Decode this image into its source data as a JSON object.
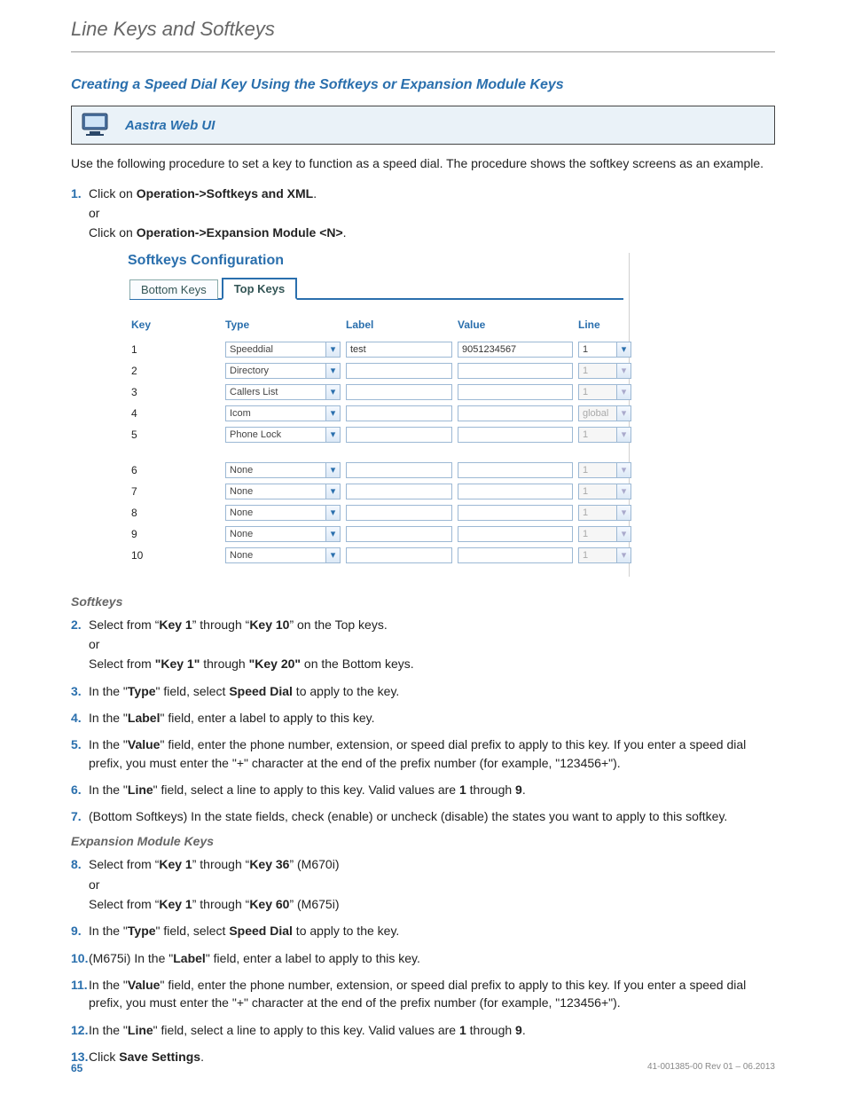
{
  "header": "Line Keys and Softkeys",
  "section_title": "Creating a Speed Dial Key Using the Softkeys or Expansion Module Keys",
  "callout_title": "Aastra Web UI",
  "intro": "Use the following procedure to set a key to function as a speed dial. The procedure shows the softkey screens as an example.",
  "step1": {
    "lead": "Click on ",
    "bold1": "Operation->Softkeys and XML",
    "tail1": ".",
    "or": "or",
    "lead2": "Click on ",
    "bold2": "Operation->Expansion Module <N>",
    "tail2": "."
  },
  "scr": {
    "title": "Softkeys Configuration",
    "tabs": {
      "bottom": "Bottom Keys",
      "top": "Top Keys"
    },
    "cols": {
      "key": "Key",
      "type": "Type",
      "label": "Label",
      "value": "Value",
      "line": "Line"
    },
    "rows": [
      {
        "key": "1",
        "type": "Speeddial",
        "label": "test",
        "value": "9051234567",
        "line": "1",
        "lineEnabled": true
      },
      {
        "key": "2",
        "type": "Directory",
        "label": "",
        "value": "",
        "line": "1",
        "lineEnabled": false
      },
      {
        "key": "3",
        "type": "Callers List",
        "label": "",
        "value": "",
        "line": "1",
        "lineEnabled": false
      },
      {
        "key": "4",
        "type": "Icom",
        "label": "",
        "value": "",
        "line": "global",
        "lineEnabled": false
      },
      {
        "key": "5",
        "type": "Phone Lock",
        "label": "",
        "value": "",
        "line": "1",
        "lineEnabled": false
      },
      {
        "key": "6",
        "type": "None",
        "label": "",
        "value": "",
        "line": "1",
        "lineEnabled": false
      },
      {
        "key": "7",
        "type": "None",
        "label": "",
        "value": "",
        "line": "1",
        "lineEnabled": false
      },
      {
        "key": "8",
        "type": "None",
        "label": "",
        "value": "",
        "line": "1",
        "lineEnabled": false
      },
      {
        "key": "9",
        "type": "None",
        "label": "",
        "value": "",
        "line": "1",
        "lineEnabled": false
      },
      {
        "key": "10",
        "type": "None",
        "label": "",
        "value": "",
        "line": "1",
        "lineEnabled": false
      }
    ]
  },
  "softkeys_heading": "Softkeys",
  "steps_a": {
    "s2a": "Select from “",
    "s2b": "Key 1",
    "s2c": "” through “",
    "s2d": "Key 10",
    "s2e": "” on the Top keys.",
    "s2or": "or",
    "s2f": "Select from ",
    "s2g": "\"Key 1\"",
    "s2h": " through ",
    "s2i": "\"Key 20\"",
    "s2j": " on the Bottom keys.",
    "s3a": "In the \"",
    "s3b": "Type",
    "s3c": "\" field, select ",
    "s3d": "Speed Dial",
    "s3e": " to apply to the key.",
    "s4a": "In the \"",
    "s4b": "Label",
    "s4c": "\" field, enter a label to apply to this key.",
    "s5a": "In the \"",
    "s5b": "Value",
    "s5c": "\" field, enter the phone number, extension, or speed dial prefix to apply to this key. If you enter a speed dial prefix, you must enter the \"+\" character at the end of the prefix number (for example, \"123456+\").",
    "s6a": "In the \"",
    "s6b": "Line",
    "s6c": "\" field, select a line to apply to this key. Valid values are ",
    "s6d": "1",
    "s6e": " through ",
    "s6f": "9",
    "s6g": ".",
    "s7": "(Bottom Softkeys) In the state fields, check (enable) or uncheck (disable) the states you want to apply to this softkey."
  },
  "exp_heading": "Expansion Module Keys",
  "steps_b": {
    "s8a": "Select from “",
    "s8b": "Key 1",
    "s8c": "” through “",
    "s8d": "Key 36",
    "s8e": "” (M670i)",
    "s8or": "or",
    "s8f": "Select from “",
    "s8g": "Key 1",
    "s8h": "” through “",
    "s8i": "Key 60",
    "s8j": "” (M675i)",
    "s9a": "In the \"",
    "s9b": "Type",
    "s9c": "\" field, select ",
    "s9d": "Speed Dial",
    "s9e": " to apply to the key.",
    "s10a": "(M675i) In the \"",
    "s10b": "Label",
    "s10c": "\" field, enter a label to apply to this key.",
    "s11a": "In the \"",
    "s11b": "Value",
    "s11c": "\" field, enter the phone number, extension, or speed dial prefix to apply to this key. If you enter a speed dial prefix, you must enter the \"+\" character at the end of the prefix number (for example, \"123456+\").",
    "s12a": "In the \"",
    "s12b": "Line",
    "s12c": "\" field, select a line to apply to this key. Valid values are ",
    "s12d": "1",
    "s12e": " through ",
    "s12f": "9",
    "s12g": ".",
    "s13a": "Click ",
    "s13b": "Save Settings",
    "s13c": "."
  },
  "footer": {
    "page": "65",
    "rev": "41-001385-00 Rev 01 – 06.2013"
  },
  "nums": {
    "n1": "1.",
    "n2": "2.",
    "n3": "3.",
    "n4": "4.",
    "n5": "5.",
    "n6": "6.",
    "n7": "7.",
    "n8": "8.",
    "n9": "9.",
    "n10": "10.",
    "n11": "11.",
    "n12": "12.",
    "n13": "13."
  }
}
